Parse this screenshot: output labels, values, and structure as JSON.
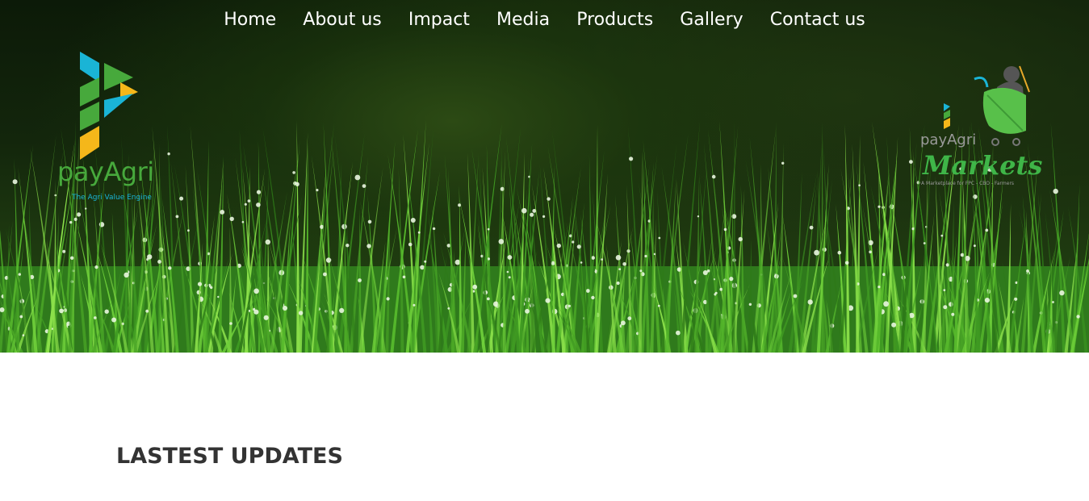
{
  "nav": {
    "items": [
      "Home",
      "About us",
      "Impact",
      "Media",
      "Products",
      "Gallery",
      "Contact us"
    ]
  },
  "logo_left": {
    "brand": "payAgri",
    "tagline": "The Agri Value Engine"
  },
  "logo_right": {
    "brand": "payAgri",
    "markets": "Markets",
    "tagline": "A Marketplace for FPC - CBO - Farmers"
  },
  "section": {
    "heading": "LASTEST UPDATES"
  },
  "colors": {
    "brand_green": "#47a93c",
    "brand_blue": "#1ab4d6",
    "brand_yellow": "#f5b71a"
  }
}
